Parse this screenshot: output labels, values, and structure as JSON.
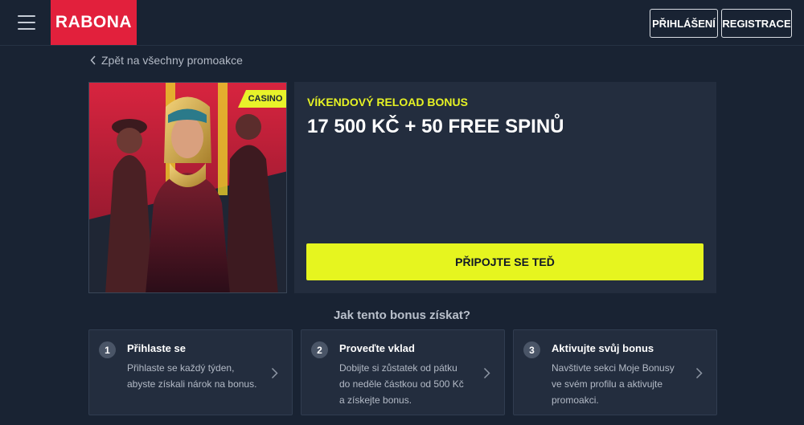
{
  "header": {
    "logo_text": "RABONA",
    "login_label": "PŘIHLÁŠENÍ",
    "register_label": "REGISTRACE"
  },
  "back_link": {
    "label": "Zpět na všechny promoakce"
  },
  "promo": {
    "badge": "CASINO",
    "subtitle": "VÍKENDOVÝ RELOAD BONUS",
    "title": "17 500 KČ + 50 FREE SPINŮ",
    "cta_label": "PŘIPOJTE SE TEĎ"
  },
  "howto": {
    "heading": "Jak tento bonus získat?",
    "steps": [
      {
        "number": "1",
        "title": "Přihlaste se",
        "description": "Přihlaste se každý týden, abyste získali nárok na bonus."
      },
      {
        "number": "2",
        "title": "Proveďte vklad",
        "description": "Dobijte si zůstatek od pátku do neděle částkou od 500 Kč a získejte bonus."
      },
      {
        "number": "3",
        "title": "Aktivujte svůj bonus",
        "description": "Navštivte sekci Moje Bonusy ve svém profilu a aktivujte promoakci."
      }
    ]
  },
  "colors": {
    "background": "#192333",
    "panel": "#232d3e",
    "brand_red": "#e2203c",
    "accent_yellow": "#e6f51f"
  },
  "icons": {
    "menu": "hamburger-icon",
    "back": "chevron-left-icon",
    "step_arrow": "chevron-right-icon"
  }
}
